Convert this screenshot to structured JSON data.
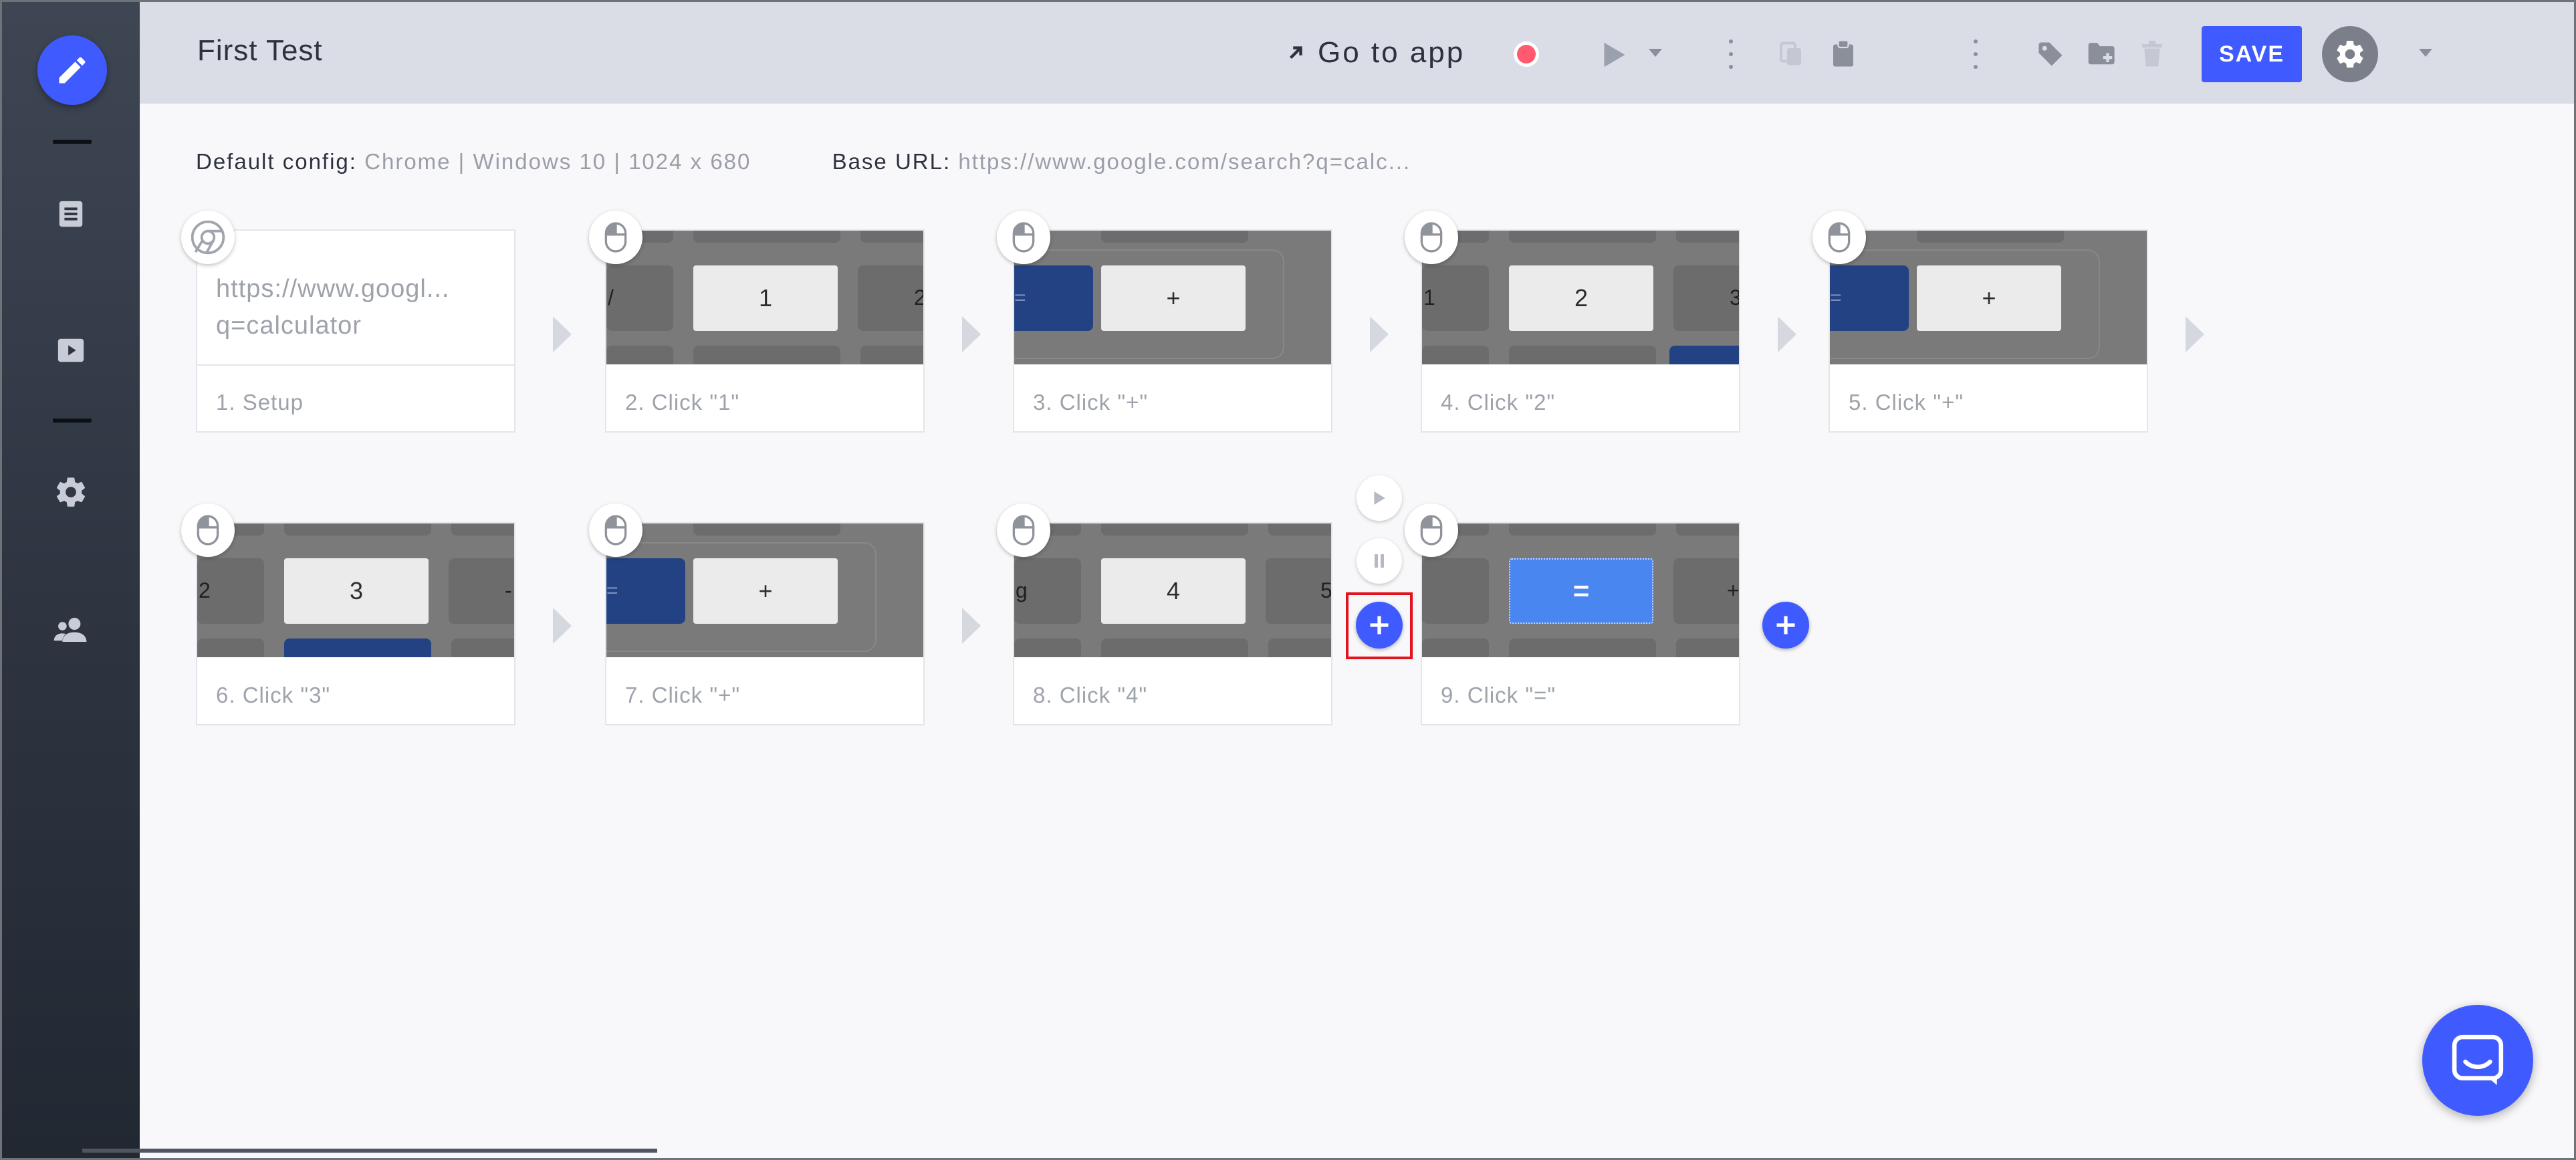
{
  "header": {
    "title": "First Test",
    "goto_label": "Go to app",
    "save_label": "SAVE"
  },
  "config": {
    "default_label": "Default config:",
    "default_value": "Chrome | Windows 10 | 1024 x 680",
    "base_label": "Base URL:",
    "base_value": "https://www.google.com/search?q=calc..."
  },
  "steps": [
    {
      "label": "1. Setup",
      "url_line1": "https://www.googl...",
      "url_line2": "q=calculator",
      "icon": "chrome-icon"
    },
    {
      "label": "2. Click \"1\"",
      "key": "1",
      "left_edge": "/",
      "right_edge": "2",
      "icon": "mouse-icon"
    },
    {
      "label": "3. Click \"+\"",
      "key": "+",
      "left_edge": "=",
      "icon": "mouse-icon"
    },
    {
      "label": "4. Click \"2\"",
      "key": "2",
      "left_edge": "1",
      "right_edge": "3",
      "icon": "mouse-icon"
    },
    {
      "label": "5. Click \"+\"",
      "key": "+",
      "left_edge": "=",
      "icon": "mouse-icon"
    },
    {
      "label": "6. Click \"3\"",
      "key": "3",
      "left_edge": "2",
      "right_edge": "-",
      "icon": "mouse-icon"
    },
    {
      "label": "7. Click \"+\"",
      "key": "+",
      "left_edge": "=",
      "icon": "mouse-icon"
    },
    {
      "label": "8. Click \"4\"",
      "key": "4",
      "left_edge": "g",
      "right_edge": "5",
      "icon": "mouse-icon"
    },
    {
      "label": "9. Click \"=\"",
      "key": "=",
      "right_edge": "+",
      "icon": "mouse-icon"
    }
  ],
  "colors": {
    "accent": "#3f5bff",
    "record": "#ff5a6e",
    "highlight": "#e3121c"
  }
}
